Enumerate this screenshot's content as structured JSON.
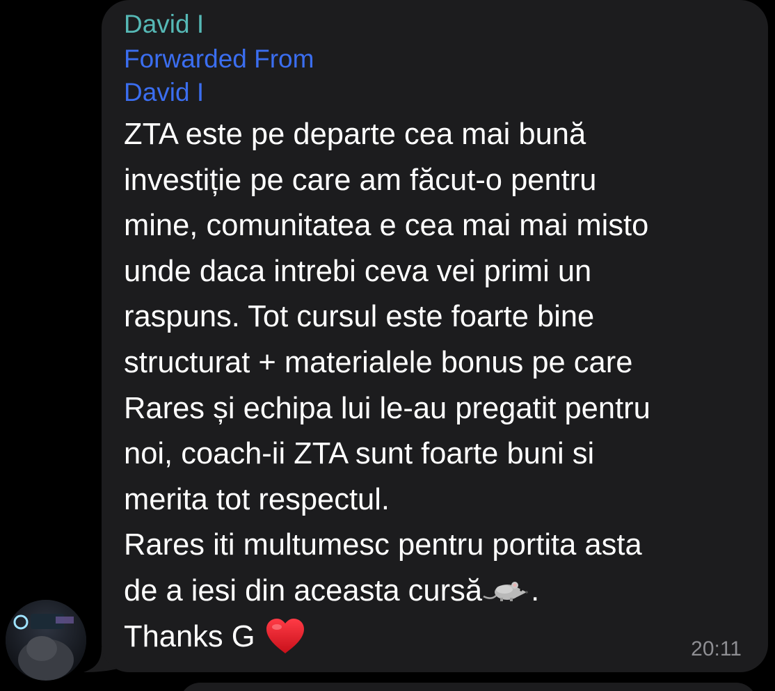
{
  "message": {
    "sender": "David I",
    "forwarded_label": "Forwarded From",
    "forwarded_from": "David I",
    "lines": [
      "ZTA este pe departe cea mai bună",
      "investiție pe care am făcut-o pentru",
      "mine, comunitatea e cea mai mai misto",
      "unde daca intrebi ceva vei primi un",
      "raspuns. Tot cursul este foarte bine",
      "structurat + materialele bonus pe care",
      "Rares și echipa lui le-au pregatit pentru",
      "noi, coach-ii ZTA sunt foarte buni si",
      "merita tot respectul.",
      "Rares iti multumesc pentru portita asta"
    ],
    "line_11_before_emoji": "de a iesi din aceasta cursă",
    "line_11_after_emoji": ".",
    "line_12": " Thanks G",
    "emoji_rat": "rat-icon",
    "emoji_heart": "heart-icon",
    "time": "20:11"
  },
  "colors": {
    "background": "#000000",
    "bubble": "#1c1c1e",
    "sender_name": "#56b9b6",
    "forwarded": "#3b6ef0",
    "text": "#ffffff",
    "timestamp": "#8e8e93"
  }
}
